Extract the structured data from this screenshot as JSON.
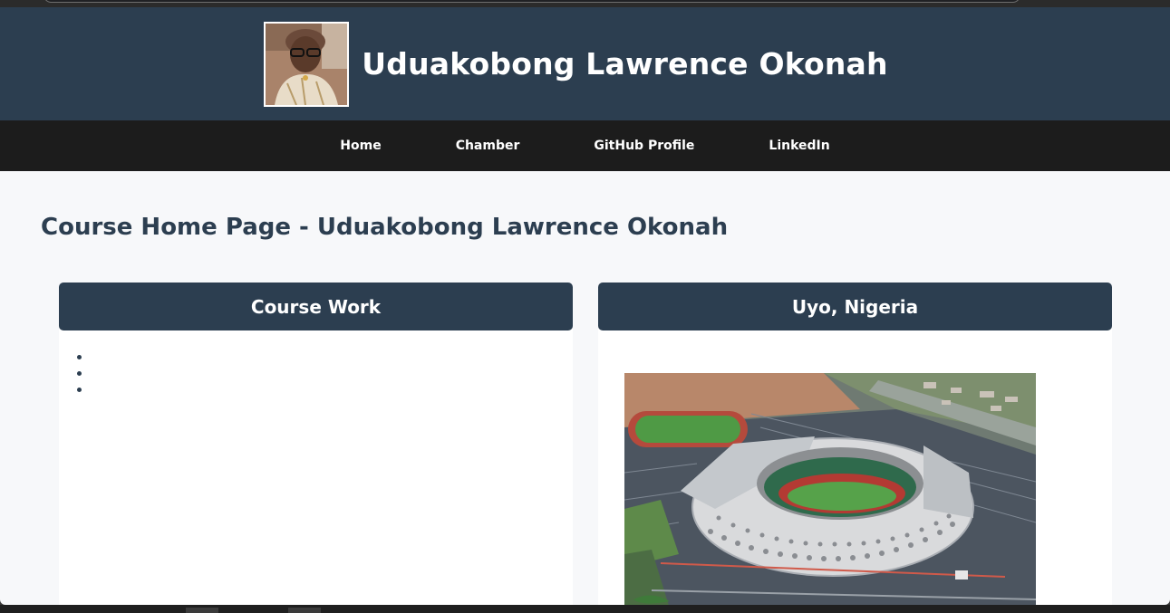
{
  "header": {
    "title": "Uduakobong Lawrence Okonah",
    "photo_alt": "profile photo"
  },
  "nav": {
    "items": [
      "Home",
      "Chamber",
      "GitHub Profile",
      "LinkedIn"
    ]
  },
  "main": {
    "heading": "Course Home Page - Uduakobong Lawrence Okonah",
    "course_card": {
      "title": "Course Work",
      "item_count": 3
    },
    "location_card": {
      "title": "Uyo, Nigeria"
    }
  },
  "colors": {
    "header_bg": "#2c3e50",
    "nav_bg": "#1c1c1c",
    "page_bg": "#f7f8fa",
    "card_bg": "#ffffff"
  }
}
